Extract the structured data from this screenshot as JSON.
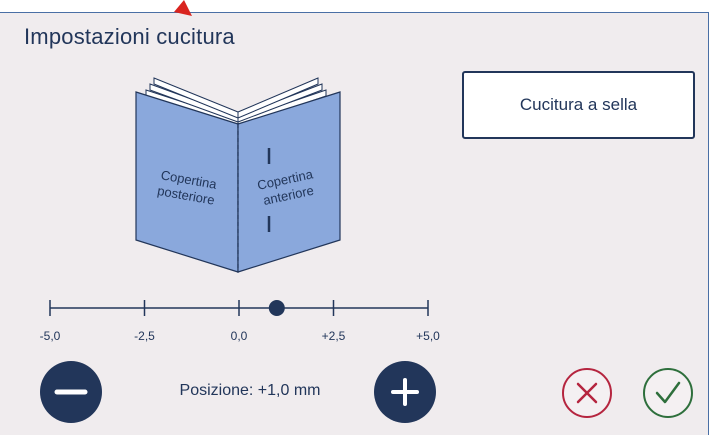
{
  "title": "Impostazioni cucitura",
  "mode_button": {
    "label": "Cucitura a sella"
  },
  "book": {
    "left_label_1": "Copertina",
    "left_label_2": "posteriore",
    "right_label_1": "Copertina",
    "right_label_2": "anteriore"
  },
  "scale": {
    "ticks": [
      "-5,0",
      "-2,5",
      "0,0",
      "+2,5",
      "+5,0"
    ],
    "min": -5.0,
    "max": 5.0,
    "value": 1.0
  },
  "position_text": "Posizione: +1,0 mm",
  "icons": {
    "minus": "minus-icon",
    "plus": "plus-icon",
    "cancel": "x-icon",
    "confirm": "check-icon",
    "pointer": "triangle-pointer-icon"
  },
  "colors": {
    "navy": "#22365a",
    "book_blue": "#8aa8dc",
    "cancel_red": "#b5253f",
    "confirm_green": "#2e6f3c",
    "pointer_red": "#d9241f"
  }
}
